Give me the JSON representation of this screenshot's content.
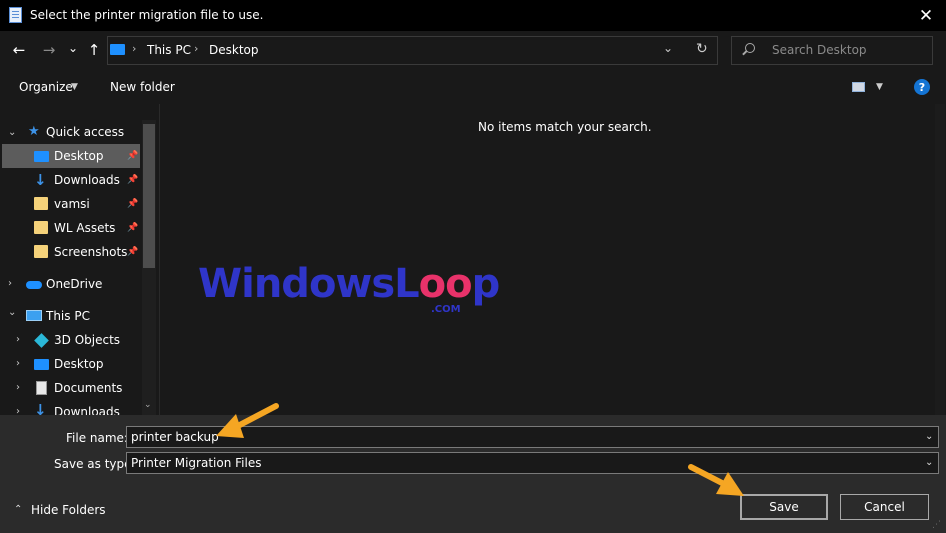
{
  "window": {
    "title": "Select the printer migration file to use.",
    "close_icon": "close-icon",
    "close_glyph": "✕"
  },
  "nav": {
    "back_glyph": "←",
    "forward_glyph": "→",
    "recent_glyph": "⌄",
    "up_glyph": "↑",
    "breadcrumb": [
      "This PC",
      "Desktop"
    ],
    "dropdown_glyph": "⌄",
    "refresh_glyph": "↻",
    "search_placeholder": "Search Desktop"
  },
  "toolbar": {
    "organize_label": "Organize",
    "new_folder_label": "New folder",
    "help_glyph": "?"
  },
  "sidebar": {
    "quick_access": "Quick access",
    "quick_items": [
      "Desktop",
      "Downloads",
      "vamsi",
      "WL Assets",
      "Screenshots"
    ],
    "onedrive": "OneDrive",
    "this_pc": "This PC",
    "pc_items": [
      "3D Objects",
      "Desktop",
      "Documents",
      "Downloads"
    ],
    "selected": "Desktop"
  },
  "content": {
    "empty_message": "No items match your search."
  },
  "watermark": {
    "text_a": "WindowsL",
    "text_b": "oo",
    "text_c": "p",
    "suffix": ".COM"
  },
  "form": {
    "file_name_label": "File name:",
    "file_name_value": "printer backup",
    "save_type_label": "Save as type:",
    "save_type_value": "Printer Migration Files",
    "hide_folders_label": "Hide Folders",
    "save_label": "Save",
    "cancel_label": "Cancel"
  },
  "colors": {
    "background": "#191919",
    "titlebar": "#000000",
    "bottom_panel": "#2b2b2b",
    "selection": "#5c5c5c",
    "accent_blue": "#1e90ff",
    "annotation_arrow": "#f5a623",
    "watermark_blue": "#2f35c9",
    "watermark_pink": "#e8326a"
  }
}
